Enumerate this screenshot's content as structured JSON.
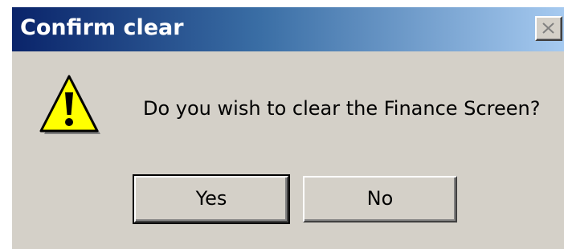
{
  "dialog": {
    "title": "Confirm clear",
    "message": "Do you wish to clear the Finance Screen?",
    "buttons": {
      "yes_label": "Yes",
      "no_label": "No"
    },
    "icon": "warning-icon",
    "close_icon": "close-icon"
  },
  "colors": {
    "titlebar_start": "#0a246a",
    "titlebar_end": "#a6caf0",
    "face": "#d4d0c8",
    "warning_fill": "#ffff00"
  }
}
